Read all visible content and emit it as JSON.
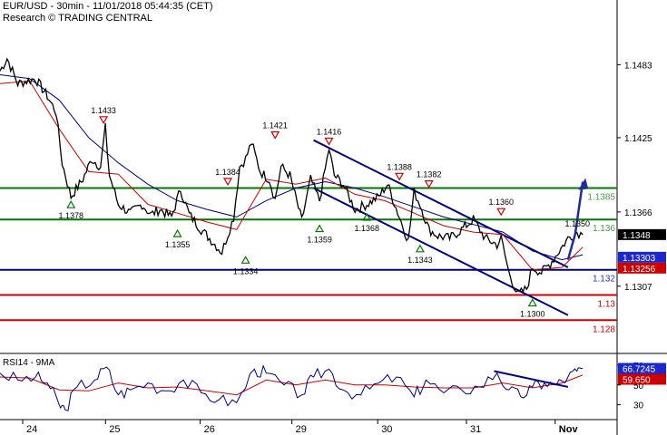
{
  "header": {
    "line1": "EUR/USD - 30min - 11/01/2018 05:44:35 (CET)",
    "line2": "Research © TRADING CENTRAL"
  },
  "colors": {
    "price": "#000000",
    "ma_fast": "#cc0000",
    "ma_slow": "#000080",
    "support_green": "#007a00",
    "pivot_navy": "#000080",
    "support_red": "#cc0000",
    "channel": "#000080",
    "arrow": "#1f2f8f",
    "label_green": "#4c9a4c",
    "label_navy": "#1f3f9f",
    "label_red": "#cc0000",
    "tag_current": "#000000",
    "tag_blue": "#1c28c9",
    "tag_red": "#cc0000",
    "marker_down": "#cc0000",
    "marker_up": "#007a00",
    "rsi": "#000080",
    "rsi_ma": "#cc0000"
  },
  "chart_data": [
    {
      "type": "line",
      "name": "EUR/USD 30min price chart",
      "x_labels": [
        "24",
        "25",
        "26",
        "29",
        "30",
        "31",
        "Nov"
      ],
      "y_ticks": [
        1.1483,
        1.1425,
        1.1366,
        1.1307
      ],
      "ylim": [
        1.1255,
        1.152
      ],
      "levels": [
        {
          "value": 1.1385,
          "label": "1.1385",
          "style": "green"
        },
        {
          "value": 1.136,
          "label": "1.136",
          "style": "green"
        },
        {
          "value": 1.132,
          "label": "1.132",
          "style": "navy"
        },
        {
          "value": 1.13,
          "label": "1.13",
          "style": "red"
        },
        {
          "value": 1.128,
          "label": "1.128",
          "style": "red"
        }
      ],
      "price_tags": [
        {
          "value": 1.1348,
          "label": "1.1348",
          "style": "current"
        },
        {
          "value": 1.133,
          "label": "1.13303",
          "style": "blue"
        },
        {
          "value": 1.1326,
          "label": "1.13256",
          "style": "red"
        }
      ],
      "swing_labels": [
        {
          "x": 0.175,
          "value": 1.1433,
          "label": "1.1433",
          "dir": "down"
        },
        {
          "x": 0.465,
          "value": 1.1421,
          "label": "1.1421",
          "dir": "down"
        },
        {
          "x": 0.556,
          "value": 1.1416,
          "label": "1.1416",
          "dir": "down"
        },
        {
          "x": 0.385,
          "value": 1.1384,
          "label": "1.1384",
          "dir": "down"
        },
        {
          "x": 0.675,
          "value": 1.1388,
          "label": "1.1388",
          "dir": "down"
        },
        {
          "x": 0.725,
          "value": 1.1382,
          "label": "1.1382",
          "dir": "down"
        },
        {
          "x": 0.847,
          "value": 1.136,
          "label": "1.1360",
          "dir": "down"
        },
        {
          "x": 0.985,
          "value": 1.135,
          "label": "1.1350",
          "dir": "none"
        },
        {
          "x": 0.12,
          "value": 1.1378,
          "label": "1.1378",
          "dir": "up"
        },
        {
          "x": 0.3,
          "value": 1.1355,
          "label": "1.1355",
          "dir": "up"
        },
        {
          "x": 0.415,
          "value": 1.1334,
          "label": "1.1334",
          "dir": "up"
        },
        {
          "x": 0.54,
          "value": 1.1359,
          "label": "1.1359",
          "dir": "up"
        },
        {
          "x": 0.62,
          "value": 1.1368,
          "label": "1.1368",
          "dir": "up"
        },
        {
          "x": 0.71,
          "value": 1.1343,
          "label": "1.1343",
          "dir": "up"
        },
        {
          "x": 0.9,
          "value": 1.13,
          "label": "1.1300",
          "dir": "up"
        }
      ],
      "price_path": {
        "x": [
          0,
          0.012,
          0.03,
          0.06,
          0.08,
          0.095,
          0.105,
          0.12,
          0.14,
          0.155,
          0.17,
          0.178,
          0.185,
          0.2,
          0.22,
          0.24,
          0.255,
          0.27,
          0.29,
          0.305,
          0.32,
          0.34,
          0.36,
          0.375,
          0.385,
          0.395,
          0.405,
          0.415,
          0.425,
          0.44,
          0.455,
          0.465,
          0.475,
          0.49,
          0.51,
          0.525,
          0.54,
          0.556,
          0.565,
          0.58,
          0.6,
          0.62,
          0.64,
          0.655,
          0.675,
          0.69,
          0.7,
          0.71,
          0.725,
          0.74,
          0.76,
          0.78,
          0.8,
          0.82,
          0.84,
          0.847,
          0.86,
          0.875,
          0.89,
          0.9,
          0.915,
          0.93,
          0.945,
          0.96,
          0.975,
          0.985
        ],
        "y": [
          1.1478,
          1.1488,
          1.1468,
          1.1472,
          1.1458,
          1.1445,
          1.1405,
          1.1378,
          1.1392,
          1.1408,
          1.1402,
          1.1433,
          1.1395,
          1.1372,
          1.1365,
          1.1372,
          1.1364,
          1.1368,
          1.1362,
          1.1384,
          1.1364,
          1.1352,
          1.1342,
          1.1334,
          1.1348,
          1.1362,
          1.1402,
          1.1408,
          1.1421,
          1.1398,
          1.1392,
          1.1376,
          1.1402,
          1.1395,
          1.1359,
          1.1392,
          1.1375,
          1.1416,
          1.1395,
          1.1388,
          1.1368,
          1.1372,
          1.1378,
          1.1388,
          1.1362,
          1.1343,
          1.1382,
          1.1372,
          1.1352,
          1.1347,
          1.1345,
          1.1352,
          1.136,
          1.1345,
          1.134,
          1.1345,
          1.1318,
          1.13,
          1.1305,
          1.1322,
          1.1318,
          1.1325,
          1.1335,
          1.1345,
          1.135,
          1.1348
        ]
      },
      "ma_fast_path": {
        "x": [
          0,
          0.05,
          0.1,
          0.15,
          0.2,
          0.25,
          0.3,
          0.35,
          0.4,
          0.45,
          0.5,
          0.55,
          0.6,
          0.65,
          0.7,
          0.75,
          0.8,
          0.85,
          0.9,
          0.95,
          0.985
        ],
        "y": [
          1.1468,
          1.147,
          1.1432,
          1.1398,
          1.1396,
          1.1372,
          1.1365,
          1.1358,
          1.1352,
          1.1392,
          1.1388,
          1.1393,
          1.138,
          1.1375,
          1.1365,
          1.1355,
          1.135,
          1.1348,
          1.132,
          1.1322,
          1.1338
        ]
      },
      "ma_slow_path": {
        "x": [
          0,
          0.05,
          0.1,
          0.15,
          0.2,
          0.25,
          0.3,
          0.35,
          0.4,
          0.45,
          0.5,
          0.55,
          0.6,
          0.65,
          0.7,
          0.75,
          0.8,
          0.85,
          0.9,
          0.95,
          0.985
        ],
        "y": [
          1.1475,
          1.1472,
          1.1455,
          1.1425,
          1.1405,
          1.1388,
          1.1375,
          1.1368,
          1.1362,
          1.1375,
          1.1385,
          1.139,
          1.1385,
          1.1378,
          1.137,
          1.1362,
          1.1356,
          1.135,
          1.1335,
          1.1328,
          1.1332
        ]
      },
      "channel_upper": {
        "x": [
          0.53,
          0.96
        ],
        "y": [
          1.1423,
          1.1322
        ]
      },
      "channel_lower": {
        "x": [
          0.53,
          0.96
        ],
        "y": [
          1.1385,
          1.1284
        ]
      },
      "projection_arrow": {
        "x": [
          0.96,
          0.972,
          0.985
        ],
        "y": [
          1.1328,
          1.1348,
          1.139
        ]
      }
    },
    {
      "type": "line",
      "name": "RSI14 - 9MA",
      "title": "RSI14 - 9MA",
      "y_ticks": [
        70,
        50,
        30
      ],
      "ylim": [
        15,
        80
      ],
      "tags": [
        {
          "value": 66.7245,
          "label": "66.7245",
          "style": "blue"
        },
        {
          "value": 59.65,
          "label": "59.650",
          "style": "red"
        }
      ],
      "rsi": [
        {
          "x": 0.0,
          "y": 62
        },
        {
          "x": 0.03,
          "y": 55
        },
        {
          "x": 0.06,
          "y": 58
        },
        {
          "x": 0.08,
          "y": 52
        },
        {
          "x": 0.1,
          "y": 30
        },
        {
          "x": 0.11,
          "y": 25
        },
        {
          "x": 0.13,
          "y": 48
        },
        {
          "x": 0.16,
          "y": 55
        },
        {
          "x": 0.18,
          "y": 68
        },
        {
          "x": 0.2,
          "y": 40
        },
        {
          "x": 0.22,
          "y": 45
        },
        {
          "x": 0.25,
          "y": 52
        },
        {
          "x": 0.28,
          "y": 44
        },
        {
          "x": 0.31,
          "y": 55
        },
        {
          "x": 0.34,
          "y": 42
        },
        {
          "x": 0.37,
          "y": 35
        },
        {
          "x": 0.4,
          "y": 32
        },
        {
          "x": 0.43,
          "y": 66
        },
        {
          "x": 0.45,
          "y": 62
        },
        {
          "x": 0.48,
          "y": 50
        },
        {
          "x": 0.51,
          "y": 40
        },
        {
          "x": 0.53,
          "y": 58
        },
        {
          "x": 0.556,
          "y": 66
        },
        {
          "x": 0.58,
          "y": 45
        },
        {
          "x": 0.61,
          "y": 40
        },
        {
          "x": 0.64,
          "y": 52
        },
        {
          "x": 0.67,
          "y": 58
        },
        {
          "x": 0.7,
          "y": 38
        },
        {
          "x": 0.72,
          "y": 55
        },
        {
          "x": 0.75,
          "y": 42
        },
        {
          "x": 0.78,
          "y": 45
        },
        {
          "x": 0.81,
          "y": 48
        },
        {
          "x": 0.84,
          "y": 62
        },
        {
          "x": 0.86,
          "y": 45
        },
        {
          "x": 0.88,
          "y": 38
        },
        {
          "x": 0.9,
          "y": 48
        },
        {
          "x": 0.92,
          "y": 52
        },
        {
          "x": 0.94,
          "y": 50
        },
        {
          "x": 0.96,
          "y": 58
        },
        {
          "x": 0.975,
          "y": 64
        },
        {
          "x": 0.985,
          "y": 67
        }
      ],
      "rsi_ma": [
        {
          "x": 0.0,
          "y": 58
        },
        {
          "x": 0.05,
          "y": 57
        },
        {
          "x": 0.1,
          "y": 45
        },
        {
          "x": 0.15,
          "y": 44
        },
        {
          "x": 0.2,
          "y": 52
        },
        {
          "x": 0.25,
          "y": 47
        },
        {
          "x": 0.3,
          "y": 48
        },
        {
          "x": 0.35,
          "y": 44
        },
        {
          "x": 0.4,
          "y": 40
        },
        {
          "x": 0.45,
          "y": 55
        },
        {
          "x": 0.5,
          "y": 50
        },
        {
          "x": 0.55,
          "y": 55
        },
        {
          "x": 0.6,
          "y": 50
        },
        {
          "x": 0.65,
          "y": 50
        },
        {
          "x": 0.7,
          "y": 48
        },
        {
          "x": 0.75,
          "y": 47
        },
        {
          "x": 0.8,
          "y": 47
        },
        {
          "x": 0.85,
          "y": 52
        },
        {
          "x": 0.9,
          "y": 47
        },
        {
          "x": 0.95,
          "y": 52
        },
        {
          "x": 0.985,
          "y": 60
        }
      ],
      "trendline": {
        "x": [
          0.835,
          0.96
        ],
        "y": [
          64,
          48
        ]
      }
    }
  ]
}
